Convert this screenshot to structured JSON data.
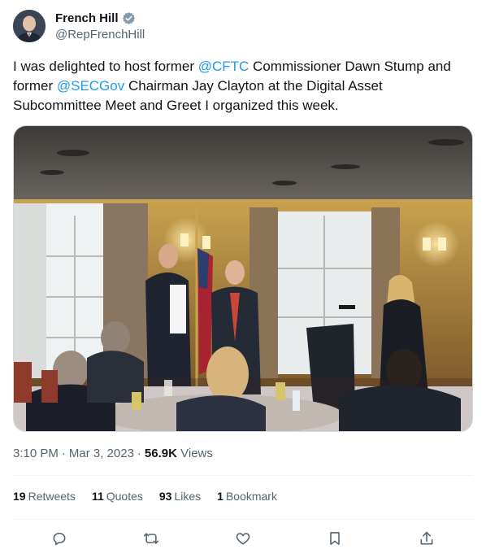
{
  "author": {
    "name": "French Hill",
    "handle": "@RepFrenchHill",
    "verified_icon": "verified-badge-icon"
  },
  "tweet": {
    "text_part1": "I was delighted to host former ",
    "mention1": "@CFTC",
    "text_part2": " Commissioner Dawn Stump and former ",
    "mention2": "@SECGov",
    "text_part3": " Chairman Jay Clayton at the Digital Asset Subcommittee Meet and Greet I organized this week."
  },
  "meta": {
    "time": "3:10 PM",
    "sep1": "·",
    "date": "Mar 3, 2023",
    "sep2": "·",
    "views_count": "56.9K",
    "views_label": "Views"
  },
  "stats": {
    "retweets_count": "19",
    "retweets_label": "Retweets",
    "quotes_count": "11",
    "quotes_label": "Quotes",
    "likes_count": "93",
    "likes_label": "Likes",
    "bookmarks_count": "1",
    "bookmarks_label": "Bookmark"
  },
  "actions": {
    "reply_icon": "reply-icon",
    "retweet_icon": "retweet-icon",
    "like_icon": "heart-icon",
    "bookmark_icon": "bookmark-icon",
    "share_icon": "share-icon"
  },
  "colors": {
    "accent": "#1d9bf0",
    "text_primary": "#0f1419",
    "text_secondary": "#536471",
    "divider": "#eff3f4"
  }
}
